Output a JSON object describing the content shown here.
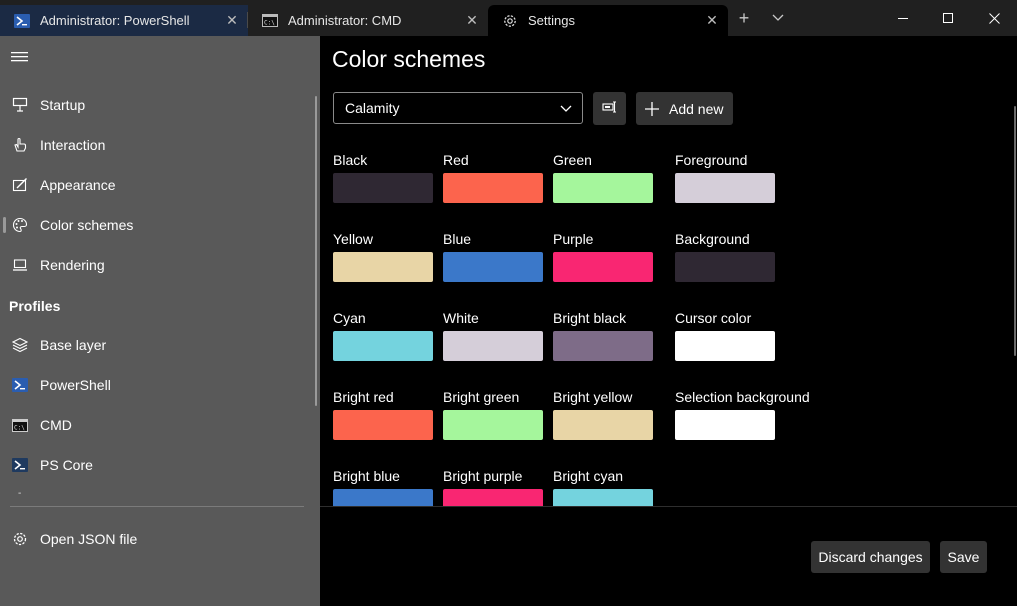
{
  "tabs": [
    {
      "title": "Administrator: PowerShell",
      "icon": "powershell-icon",
      "active": false
    },
    {
      "title": "Administrator: CMD",
      "icon": "cmd-icon",
      "active": false
    },
    {
      "title": "Settings",
      "icon": "gear-icon",
      "active": true
    }
  ],
  "titlebar": {
    "new_tab_icon": "plus-icon",
    "dropdown_icon": "chevron-down-icon",
    "minimize_icon": "minimize-icon",
    "maximize_icon": "maximize-icon",
    "close_icon": "close-icon"
  },
  "sidebar": {
    "menu_icon": "hamburger-icon",
    "items": [
      {
        "label": "Startup",
        "icon": "monitor-pin-icon"
      },
      {
        "label": "Interaction",
        "icon": "hand-pointer-icon"
      },
      {
        "label": "Appearance",
        "icon": "paint-brush-icon"
      },
      {
        "label": "Color schemes",
        "icon": "palette-icon",
        "selected": true
      },
      {
        "label": "Rendering",
        "icon": "laptop-icon"
      }
    ],
    "profiles_heading": "Profiles",
    "profiles": [
      {
        "label": "Base layer",
        "icon": "layers-icon"
      },
      {
        "label": "PowerShell",
        "icon": "powershell-icon"
      },
      {
        "label": "CMD",
        "icon": "cmd-icon"
      },
      {
        "label": "PS Core",
        "icon": "ps-core-icon"
      }
    ],
    "truncated_item": "-",
    "open_json": {
      "label": "Open JSON file",
      "icon": "gear-icon"
    }
  },
  "main": {
    "title": "Color schemes",
    "selected_scheme": "Calamity",
    "rename_icon": "rename-icon",
    "add_new_label": "Add new",
    "colors": [
      [
        {
          "label": "Black",
          "color": "#2f2833"
        },
        {
          "label": "Yellow",
          "color": "#e8d5a6"
        },
        {
          "label": "Cyan",
          "color": "#74d3de"
        },
        {
          "label": "Bright red",
          "color": "#fc644d"
        },
        {
          "label": "Bright blue",
          "color": "#3b78c9"
        }
      ],
      [
        {
          "label": "Red",
          "color": "#fc644d"
        },
        {
          "label": "Blue",
          "color": "#3b78c9"
        },
        {
          "label": "White",
          "color": "#d5ced9"
        },
        {
          "label": "Bright green",
          "color": "#a5f69c"
        },
        {
          "label": "Bright purple",
          "color": "#f92672"
        }
      ],
      [
        {
          "label": "Green",
          "color": "#a5f69c"
        },
        {
          "label": "Purple",
          "color": "#f92672"
        },
        {
          "label": "Bright black",
          "color": "#7e6c88"
        },
        {
          "label": "Bright yellow",
          "color": "#e8d5a6"
        },
        {
          "label": "Bright cyan",
          "color": "#74d3de"
        }
      ],
      [
        {
          "label": "Foreground",
          "color": "#d5ced9"
        },
        {
          "label": "Background",
          "color": "#2f2833"
        },
        {
          "label": "Cursor color",
          "color": "#ffffff"
        },
        {
          "label": "Selection background",
          "color": "#ffffff"
        }
      ]
    ],
    "discard_label": "Discard changes",
    "save_label": "Save"
  }
}
